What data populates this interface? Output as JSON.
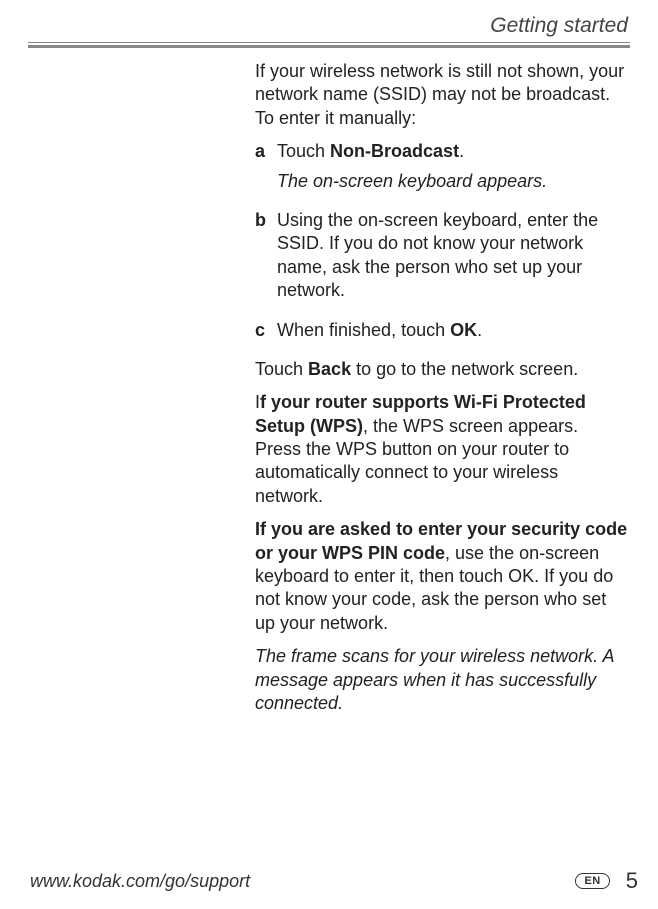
{
  "header": {
    "section_title": "Getting started"
  },
  "content": {
    "intro": "If your wireless network is still not shown, your network name (SSID) may not be broadcast. To enter it manually:",
    "steps": {
      "a": {
        "marker": "a",
        "text_pre": "Touch ",
        "bold": "Non-Broadcast",
        "text_post": ".",
        "result": "The on-screen keyboard appears."
      },
      "b": {
        "marker": "b",
        "text": "Using the on-screen keyboard, enter the SSID. If you do not know your network name, ask the person who set up your network."
      },
      "c": {
        "marker": "c",
        "text_pre": "When finished, touch ",
        "bold": "OK",
        "text_post": "."
      }
    },
    "back": {
      "pre": "Touch ",
      "bold": "Back",
      "post": " to go to the network screen."
    },
    "wps": {
      "pre": "I",
      "bold": "f your router supports Wi-Fi Protected Setup (WPS)",
      "post": ", the WPS screen appears. Press the WPS button on your router to automatically connect to your wireless network."
    },
    "security": {
      "bold": "If you are asked to enter your security code or your WPS PIN code",
      "post": ", use the on-screen keyboard to enter it, then touch OK. If you do not know your code, ask the person who set up your network."
    },
    "result": "The frame scans for your wireless network. A message appears when it has successfully connected."
  },
  "footer": {
    "url": "www.kodak.com/go/support",
    "lang": "EN",
    "page_number": "5"
  }
}
